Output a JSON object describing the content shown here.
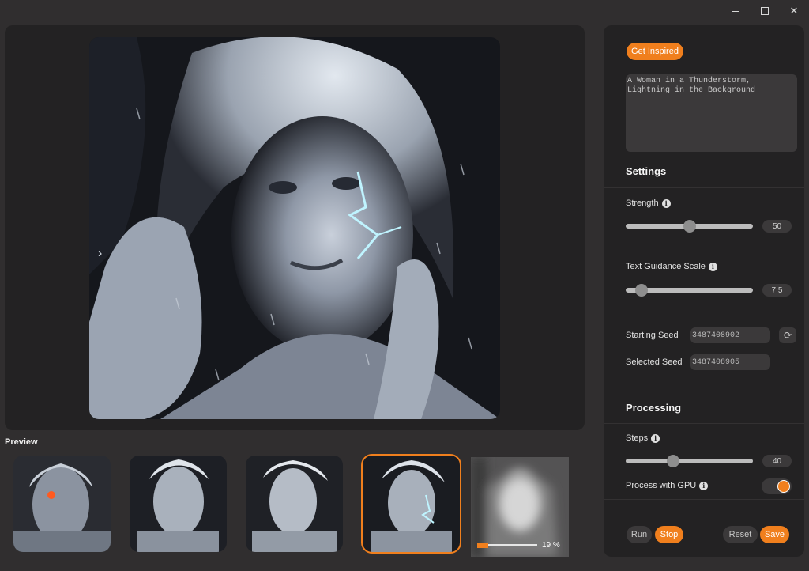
{
  "window": {
    "controls": [
      "minimize-icon",
      "maximize-icon",
      "close-icon"
    ]
  },
  "canvas": {
    "nav_arrow": "›"
  },
  "preview": {
    "label": "Preview",
    "progress_text": "19 %",
    "progress_value": 0.19,
    "selected_index": 3,
    "thumbnail_count": 5
  },
  "side": {
    "get_inspired": "Get Inspired",
    "prompt_line1": "A Woman in a Thunderstorm,",
    "prompt_line2": "Lightning in the Background",
    "settings_title": "Settings",
    "strength_label": "Strength",
    "strength_value": "50",
    "strength_level": 0.5,
    "guidance_label": "Text Guidance Scale",
    "guidance_value": "7,5",
    "guidance_level": 0.08,
    "starting_seed_label": "Starting Seed",
    "starting_seed_value": "3487408902",
    "selected_seed_label": "Selected Seed",
    "selected_seed_value": "3487408905",
    "processing_title": "Processing",
    "steps_label": "Steps",
    "steps_value": "40",
    "steps_level": 0.36,
    "gpu_label": "Process with GPU",
    "gpu_enabled": true,
    "run_label": "Run",
    "stop_label": "Stop",
    "reset_label": "Reset",
    "save_label": "Save"
  },
  "colors": {
    "accent": "#f07f1d",
    "panel": "#232223",
    "background": "#302e2f",
    "field": "#3b393a"
  }
}
